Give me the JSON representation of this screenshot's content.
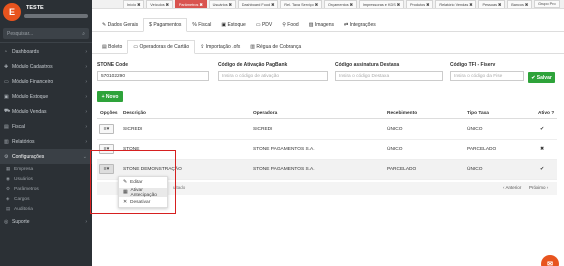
{
  "user": {
    "name": "TESTE",
    "logo_letter": "E"
  },
  "search": {
    "placeholder": "Pesquisar..."
  },
  "sidebar": {
    "items": [
      {
        "label": "Dashboards"
      },
      {
        "label": "Módulo Cadastros"
      },
      {
        "label": "Módulo Financeiro"
      },
      {
        "label": "Módulo Estoque"
      },
      {
        "label": "Módulo Vendas"
      },
      {
        "label": "Fiscal"
      },
      {
        "label": "Relatórios"
      },
      {
        "label": "Configurações"
      }
    ],
    "subitems": [
      {
        "label": "Empresa"
      },
      {
        "label": "Usuários"
      },
      {
        "label": "Parâmetros"
      },
      {
        "label": "Cargos"
      },
      {
        "label": "Auditoria"
      }
    ],
    "support": {
      "label": "Suporte"
    }
  },
  "top_tabs": [
    {
      "label": "Início"
    },
    {
      "label": "Veículos"
    },
    {
      "label": "Parâmetros"
    },
    {
      "label": "Usuários"
    },
    {
      "label": "Dashboard Food"
    },
    {
      "label": "Rel. Taxa Serviço"
    },
    {
      "label": "Orçamentos"
    },
    {
      "label": "Impressoras e KDS"
    },
    {
      "label": "Produtos"
    },
    {
      "label": "Relatório Vendas"
    },
    {
      "label": "Pessoas"
    },
    {
      "label": "Bancos"
    },
    {
      "label": "Grupo Pro"
    }
  ],
  "module_tabs": [
    {
      "label": "Dados Gerais"
    },
    {
      "label": "Pagamentos"
    },
    {
      "label": "Fiscal"
    },
    {
      "label": "Estoque"
    },
    {
      "label": "PDV"
    },
    {
      "label": "Food"
    },
    {
      "label": "Imagens"
    },
    {
      "label": "Integrações"
    }
  ],
  "sub_tabs": [
    {
      "label": "Boleto"
    },
    {
      "label": "Operadoras de Cartão"
    },
    {
      "label": "Importação .ofx"
    },
    {
      "label": "Régua de Cobrança"
    }
  ],
  "form": {
    "stone_code": {
      "label": "STONE Code",
      "value": "570102290"
    },
    "pagbank": {
      "label": "Código de Ativação PagBank",
      "placeholder": "Insira o código de ativação"
    },
    "destaxa": {
      "label": "Código assinatura Destaxa",
      "placeholder": "Insira o código Destaxa"
    },
    "tef": {
      "label": "Código TFI - Fiserv",
      "placeholder": "Insira o código da Fise"
    },
    "save_label": "Salvar",
    "novo_label": "+ Novo"
  },
  "table": {
    "headers": [
      "Opções",
      "Descrição",
      "Operadora",
      "Recebimento",
      "Tipo Taxa",
      "Ativo ?"
    ],
    "rows": [
      {
        "descricao": "SICREDI",
        "operadora": "SICREDI",
        "recebimento": "ÚNICO",
        "tipo_taxa": "ÚNICO",
        "ativo": "✔"
      },
      {
        "descricao": "STONE",
        "operadora": "STONE PAGAMENTOS S.A.",
        "recebimento": "ÚNICO",
        "tipo_taxa": "PARCELADO",
        "ativo": "✖"
      },
      {
        "descricao": "STONE DEMONSTRAÇÃO",
        "operadora": "STONE PAGAMENTOS S.A.",
        "recebimento": "PARCELADO",
        "tipo_taxa": "ÚNICO",
        "ativo": "✔"
      }
    ]
  },
  "pager": {
    "showing": "ultado",
    "prev": "‹ Anterior",
    "next": "Próximo ›"
  },
  "dropdown": {
    "items": [
      {
        "label": "Editar",
        "icon": "pencil-icon"
      },
      {
        "label": "Ativar Antecipação",
        "icon": "calendar-icon"
      },
      {
        "label": "Desativar",
        "icon": "close-icon"
      }
    ]
  },
  "colors": {
    "accent": "#2ea33a",
    "brand": "#e8541e",
    "sidebar": "#2b3035",
    "highlight": "#d62020"
  }
}
